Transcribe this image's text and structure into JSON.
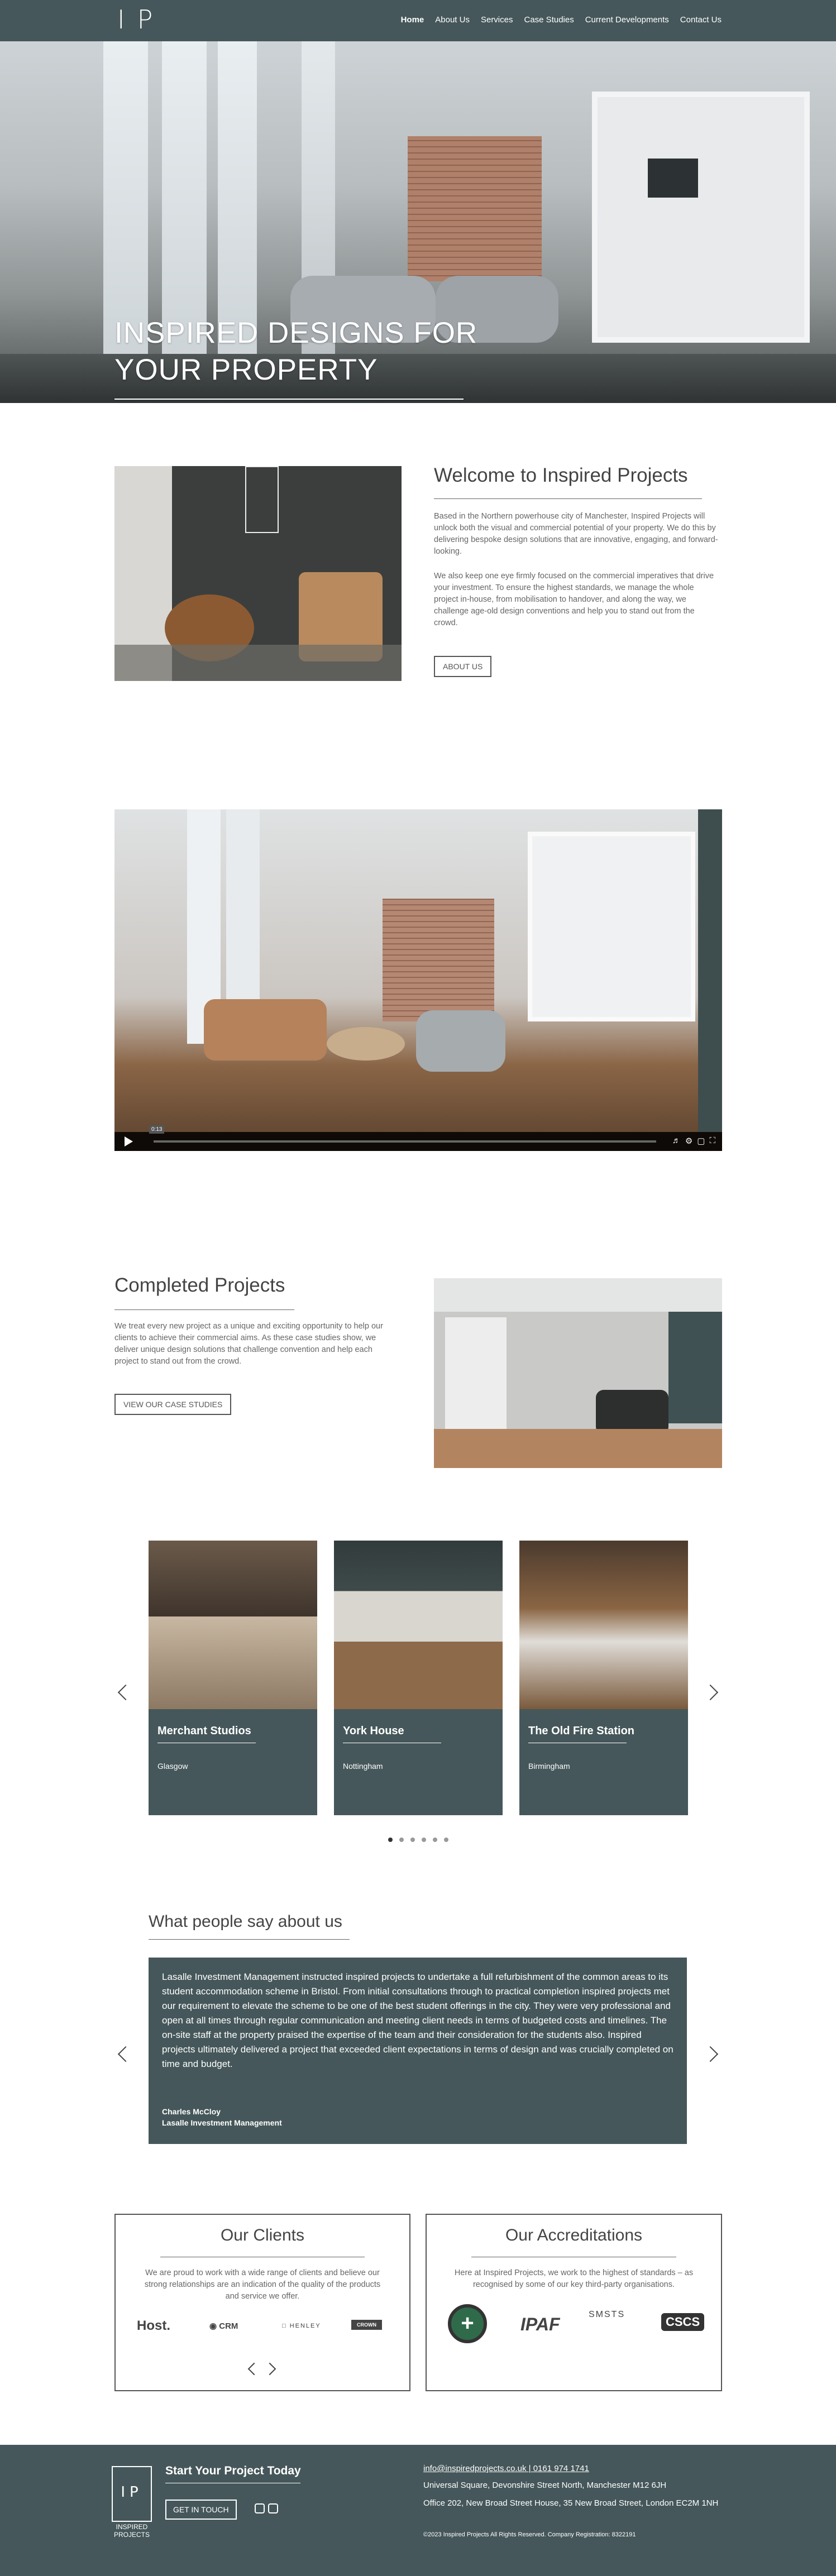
{
  "header": {
    "logo": "IP",
    "nav": [
      "Home",
      "About Us",
      "Services",
      "Case Studies",
      "Current Developments",
      "Contact Us"
    ]
  },
  "hero": {
    "title_line1": "INSPIRED DESIGNS FOR",
    "title_line2": "YOUR PROPERTY",
    "slides": 2,
    "active_slide": 1
  },
  "welcome": {
    "title": "Welcome to Inspired Projects",
    "p1": "Based in the Northern powerhouse city of Manchester, Inspired Projects will unlock both the visual and commercial potential of your property. We do this by delivering bespoke design solutions that are innovative, engaging, and forward-looking.",
    "p2": "We also keep one eye firmly focused on the commercial imperatives that drive your investment. To ensure the highest standards, we manage the whole project in-house, from mobilisation to handover, and along the way, we challenge age-old design conventions and help you to stand out from the crowd.",
    "button": "ABOUT US"
  },
  "video": {
    "time": "0:13",
    "icons": [
      "volume-icon",
      "settings-icon",
      "pip-icon",
      "fullscreen-icon"
    ]
  },
  "completed": {
    "title": "Completed Projects",
    "text": "We treat every new project as a unique and exciting opportunity to help our clients to achieve their commercial aims. As these case studies show, we deliver unique design solutions that challenge convention and help each project to stand out from the crowd.",
    "button": "VIEW OUR CASE STUDIES"
  },
  "case_studies": [
    {
      "name": "Merchant Studios",
      "location": "Glasgow"
    },
    {
      "name": "York House",
      "location": "Nottingham"
    },
    {
      "name": "The Old Fire Station",
      "location": "Birmingham"
    }
  ],
  "case_dots": 6,
  "testimonials": {
    "title": "What people say about us",
    "quote": "Lasalle Investment Management instructed inspired projects to undertake a full refurbishment of the common areas to its student accommodation scheme in Bristol. From initial consultations through to practical completion inspired projects met our requirement to elevate the scheme to be one of the best student offerings in the city. They were very professional and open at all times through regular communication and meeting client needs in terms of budgeted costs and timelines. The on-site staff at the property praised the expertise of the team and their consideration for the students also. Inspired projects ultimately delivered a project that exceeded client expectations in terms of design and was crucially completed on time and budget.",
    "name": "Charles McCloy",
    "company": "Lasalle Investment Management"
  },
  "clients": {
    "title": "Our Clients",
    "text": "We are proud to work with a wide range of clients and believe our strong relationships are an indication of the quality of the products and service we offer.",
    "logos": [
      "Host.",
      "CRM",
      "HENLEY",
      "CROWN"
    ]
  },
  "accreditations": {
    "title": "Our Accreditations",
    "text": "Here at Inspired Projects, we work to the highest of standards – as recognised by some of our key third-party organisations.",
    "logos": [
      "+",
      "IPAF",
      "SMSTS",
      "CSCS"
    ]
  },
  "footer": {
    "logo": "IP",
    "logo_text": "INSPIRED PROJECTS",
    "cta_title": "Start Your Project Today",
    "cta_button": "GET IN TOUCH",
    "contact": "info@inspiredprojects.co.uk | 0161 974 1741",
    "address1": "Universal Square, Devonshire Street North, Manchester M12 6JH",
    "address2": "Office 202, New Broad Street House, 35 New Broad Street, London EC2M 1NH",
    "legal": "©2023 Inspired Projects All Rights Reserved. Company Registration: 8322191"
  }
}
